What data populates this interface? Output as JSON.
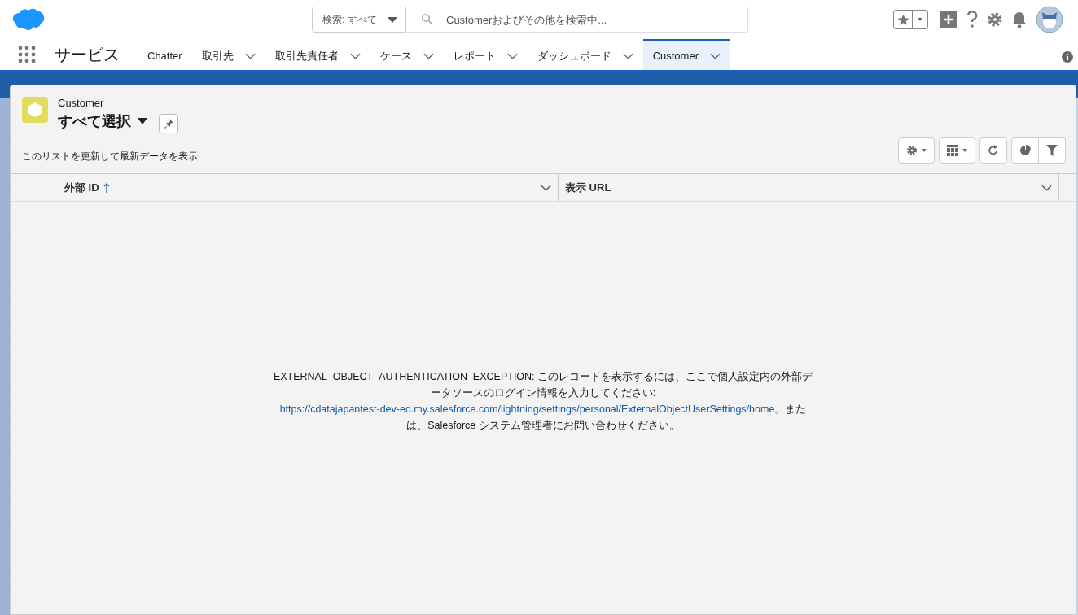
{
  "search": {
    "scope": "検索: すべて",
    "placeholder": "Customerおよびその他を検索中..."
  },
  "app_name": "サービス",
  "tabs": [
    {
      "label": "Chatter",
      "menu": false,
      "selected": false
    },
    {
      "label": "取引先",
      "menu": true,
      "selected": false
    },
    {
      "label": "取引先責任者",
      "menu": true,
      "selected": false
    },
    {
      "label": "ケース",
      "menu": true,
      "selected": false
    },
    {
      "label": "レポート",
      "menu": true,
      "selected": false
    },
    {
      "label": "ダッシュボード",
      "menu": true,
      "selected": false
    },
    {
      "label": "Customer",
      "menu": true,
      "selected": true
    }
  ],
  "list_view": {
    "object": "Customer",
    "title": "すべて選択",
    "subtitle": "このリストを更新して最新データを表示"
  },
  "columns": [
    {
      "label": "外部 ID",
      "sorted": true
    },
    {
      "label": "表示 URL",
      "sorted": false
    }
  ],
  "error_message": {
    "before": "EXTERNAL_OBJECT_AUTHENTICATION_EXCEPTION: このレコードを表示するには、ここで個人設定内の外部データソースのログイン情報を入力してください: ",
    "link": "https://cdatajapantest-dev-ed.my.salesforce.com/lightning/settings/personal/ExternalObjectUserSettings/home。",
    "after": "または、Salesforce システム管理者にお問い合わせください。"
  }
}
